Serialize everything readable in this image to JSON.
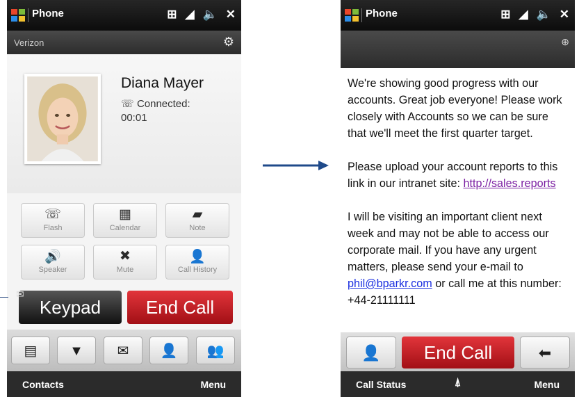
{
  "colors": {
    "accent": "#1f4a8a",
    "end_call": "#c8191f",
    "link_visited": "#7b1fa2",
    "link": "#1a2ee0"
  },
  "left_screen": {
    "title_bar": {
      "app_title": "Phone",
      "icons": [
        "network-icon",
        "signal-icon",
        "volume-icon",
        "close-icon"
      ],
      "close_label": "✕"
    },
    "carrier": "Verizon",
    "contact": {
      "name": "Diana Mayer",
      "status": "Connected:",
      "duration": "00:01"
    },
    "buttons": [
      {
        "label": "Flash",
        "icon": "flash-icon"
      },
      {
        "label": "Calendar",
        "icon": "calendar-icon"
      },
      {
        "label": "Note",
        "icon": "note-icon"
      },
      {
        "label": "Speaker",
        "icon": "speaker-icon"
      },
      {
        "label": "Mute",
        "icon": "mute-icon"
      },
      {
        "label": "Call History",
        "icon": "call-history-icon"
      }
    ],
    "keypad_label": "Keypad",
    "end_call_label": "End Call",
    "dock": [
      "contact-card-icon",
      "message-icon",
      "email-icon",
      "contact-history-icon",
      "contacts-icon"
    ],
    "softkeys": {
      "left": "Contacts",
      "right": "Menu"
    }
  },
  "right_screen": {
    "title_bar": {
      "app_title": "Phone",
      "close_label": "✕"
    },
    "message": {
      "p1": "We're showing good progress with our accounts. Great job everyone! Please work closely with Accounts so we can be sure that we'll meet the first quarter target.",
      "p2_prefix": "Please upload your account reports to this link in our intranet site: ",
      "p2_link": "http://sales.reports",
      "p3_prefix": "I will be visiting an important client next week and may not be able to access our corporate mail. If you have any urgent matters, please send your e-mail to ",
      "p3_email": "phil@bparkr.com",
      "p3_mid": " or call me at this number: ",
      "p3_phone": "+44-21111111"
    },
    "end_call_label": "End Call",
    "softkeys": {
      "left": "Call Status",
      "right": "Menu"
    }
  }
}
